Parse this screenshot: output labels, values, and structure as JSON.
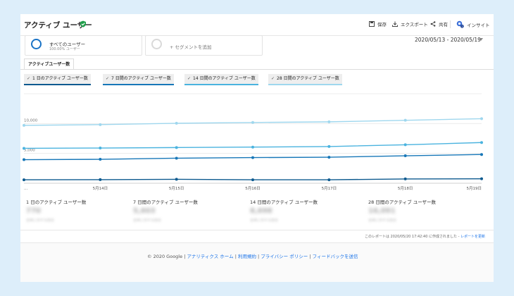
{
  "header": {
    "title": "アクティブ ユーザー",
    "actions": {
      "save": "保存",
      "export": "エクスポート",
      "share": "共有",
      "insights": "インサイト"
    }
  },
  "segments": [
    {
      "name": "すべてのユーザー",
      "sub": "100.00% ユーザー"
    },
    {
      "name": "+ セグメントを追加",
      "sub": ""
    }
  ],
  "date_range": "2020/05/13 - 2020/05/19",
  "tab": "アクティブユーザー数",
  "metrics": [
    {
      "label": "1 日のアクティブ ユーザー数",
      "color": "#0d5a8f"
    },
    {
      "label": "7 日間のアクティブ ユーザー数",
      "color": "#1777b8"
    },
    {
      "label": "14 日間のアクティブ ユーザー数",
      "color": "#4ab3df"
    },
    {
      "label": "28 日間のアクティブ ユーザー数",
      "color": "#9fd7ee"
    }
  ],
  "chart_data": {
    "type": "line",
    "x": [
      "...",
      "5月14日",
      "5月15日",
      "5月16日",
      "5月17日",
      "5月18日",
      "5月19日"
    ],
    "y_ticks": [
      "10,000",
      "5,000"
    ],
    "ylim": [
      0,
      15000
    ],
    "series": [
      {
        "name": "28 日間のアクティブ ユーザー数",
        "color": "#9fd7ee",
        "values": [
          9700,
          9820,
          10050,
          10180,
          10290,
          10550,
          10820
        ]
      },
      {
        "name": "14 日間のアクティブ ユーザー数",
        "color": "#4ab3df",
        "values": [
          5850,
          5900,
          5980,
          6060,
          6150,
          6450,
          6820
        ]
      },
      {
        "name": "7 日間のアクティブ ユーザー数",
        "color": "#1777b8",
        "values": [
          3950,
          4010,
          4200,
          4300,
          4360,
          4600,
          4820
        ]
      },
      {
        "name": "1 日のアクティブ ユーザー数",
        "color": "#0d5a8f",
        "values": [
          580,
          600,
          660,
          580,
          580,
          720,
          750
        ]
      }
    ],
    "grid": true
  },
  "summary": [
    {
      "label": "1 日のアクティブ ユーザー数",
      "value": "770",
      "sub": "全体に対する割合"
    },
    {
      "label": "7 日間のアクティブ ユーザー数",
      "value": "5,603",
      "sub": "全体に対する割合"
    },
    {
      "label": "14 日間のアクティブ ユーザー数",
      "value": "8,698",
      "sub": "全体に対する割合"
    },
    {
      "label": "28 日間のアクティブ ユーザー数",
      "value": "16,091",
      "sub": "全体に対する割合"
    }
  ],
  "report_note": {
    "text": "このレポートは 2020/05/20 17:42:40 に作成されました -",
    "link": "レポートを更新"
  },
  "footer": {
    "copyright": "© 2020 Google",
    "links": [
      "アナリティクス ホーム",
      "利用規約",
      "プライバシー ポリシー",
      "フィードバックを送信"
    ]
  }
}
